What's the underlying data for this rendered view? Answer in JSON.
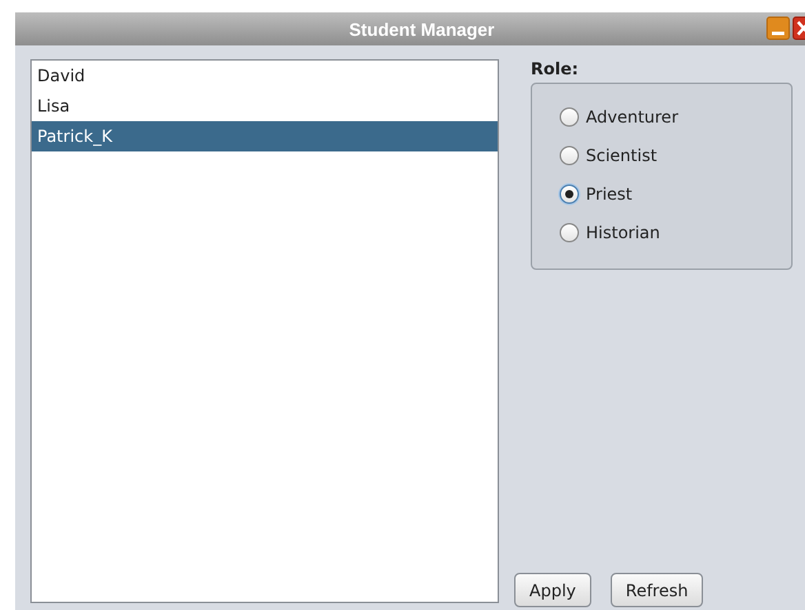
{
  "window": {
    "title": "Student Manager"
  },
  "students": [
    {
      "name": "David",
      "selected": false
    },
    {
      "name": "Lisa",
      "selected": false
    },
    {
      "name": "Patrick_K",
      "selected": true
    }
  ],
  "role": {
    "label": "Role:",
    "options": [
      {
        "label": "Adventurer",
        "selected": false
      },
      {
        "label": "Scientist",
        "selected": false
      },
      {
        "label": "Priest",
        "selected": true
      },
      {
        "label": "Historian",
        "selected": false
      }
    ]
  },
  "buttons": [
    "Apply",
    "Refresh"
  ]
}
